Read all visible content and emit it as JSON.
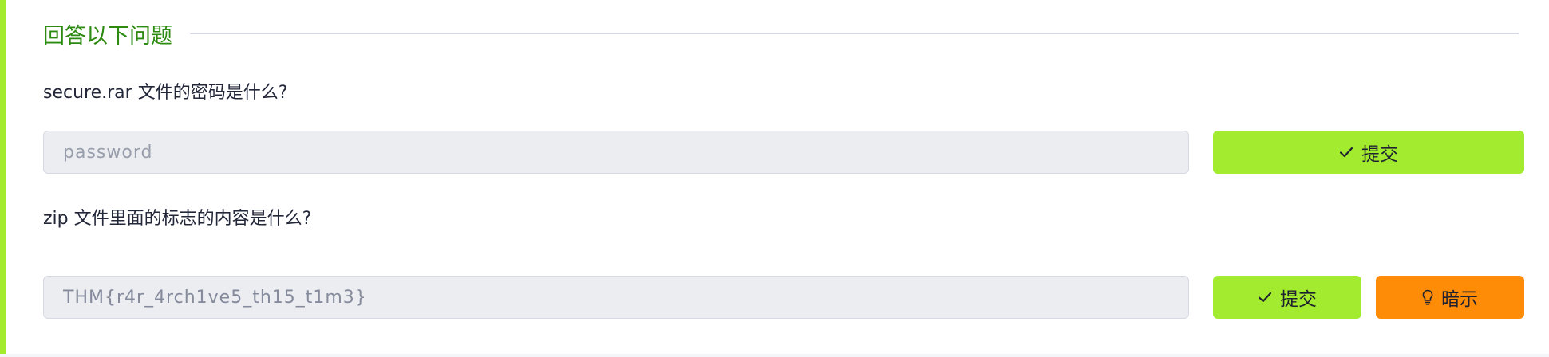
{
  "section": {
    "title": "回答以下问题"
  },
  "questions": [
    {
      "text": "secure.rar 文件的密码是什么?",
      "answer_placeholder": "password",
      "answer_value": "",
      "submit_label": "提交"
    },
    {
      "text": "zip 文件里面的标志的内容是什么?",
      "answer_placeholder": "",
      "answer_value": "THM{r4r_4rch1ve5_th15_t1m3}",
      "submit_label": "提交",
      "hint_label": "暗示"
    }
  ],
  "icons": {
    "submit": "check-icon",
    "hint": "lightbulb-icon"
  },
  "colors": {
    "accent_green": "#a2eb2e",
    "title_green": "#2e8b12",
    "hint_orange": "#ff8c07"
  }
}
